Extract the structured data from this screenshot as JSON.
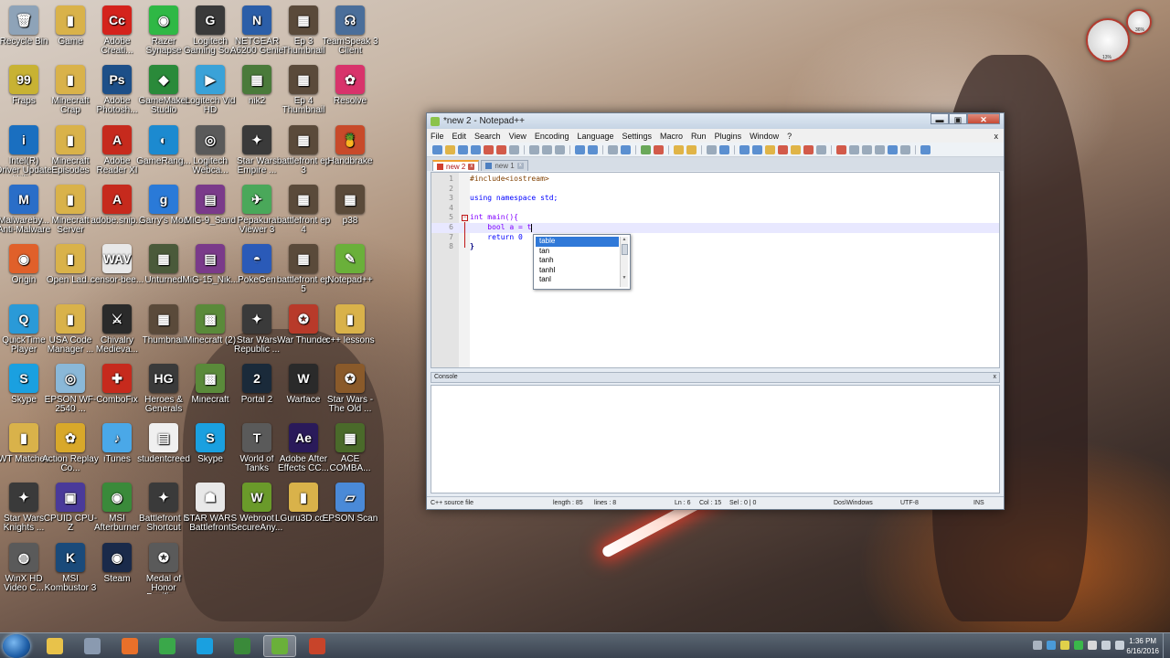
{
  "desktop": {
    "icons": [
      {
        "label": "Recycle Bin",
        "color": "#8ea3b8",
        "glyph": "🗑"
      },
      {
        "label": "Game",
        "color": "#d9b24a",
        "glyph": "▮"
      },
      {
        "label": "Adobe Creati...",
        "color": "#d4231c",
        "glyph": "Cc"
      },
      {
        "label": "Razer Synapse",
        "color": "#2fb845",
        "glyph": "◉"
      },
      {
        "label": "Logitech Gaming So...",
        "color": "#3a3a3a",
        "glyph": "G"
      },
      {
        "label": "NETGEAR A6200 Genie",
        "color": "#2b5ea8",
        "glyph": "N"
      },
      {
        "label": "Ep 3 Thumbnail",
        "color": "#5a4a3a",
        "glyph": "▦"
      },
      {
        "label": "TeamSpeak 3 Client",
        "color": "#4a6e9a",
        "glyph": "☊"
      },
      {
        "label": "Fraps",
        "color": "#c8b233",
        "glyph": "99"
      },
      {
        "label": "Minecraft Crap",
        "color": "#d9b24a",
        "glyph": "▮"
      },
      {
        "label": "Adobe Photosh...",
        "color": "#1d4f88",
        "glyph": "Ps"
      },
      {
        "label": "GameMaker Studio",
        "color": "#2a8a3a",
        "glyph": "◆"
      },
      {
        "label": "Logitech Vid HD",
        "color": "#3aa2d8",
        "glyph": "▶"
      },
      {
        "label": "nik2",
        "color": "#4a7a3a",
        "glyph": "▦"
      },
      {
        "label": "Ep 4 Thumbnail",
        "color": "#5a4a3a",
        "glyph": "▦"
      },
      {
        "label": "Resolve",
        "color": "#d8336b",
        "glyph": "✿"
      },
      {
        "label": "Intel(R) Driver Update Utili...",
        "color": "#1a6fc0",
        "glyph": "i"
      },
      {
        "label": "Minecraft Episodes",
        "color": "#d9b24a",
        "glyph": "▮"
      },
      {
        "label": "Adobe Reader XI",
        "color": "#c62a1d",
        "glyph": "A"
      },
      {
        "label": "GameRang...",
        "color": "#1c8ad0",
        "glyph": "◐"
      },
      {
        "label": "Logitech Webca...",
        "color": "#5a5a5a",
        "glyph": "◎"
      },
      {
        "label": "Star Wars Empire ...",
        "color": "#3a3a3a",
        "glyph": "✦"
      },
      {
        "label": "battlefront ep 3",
        "color": "#5a4a3a",
        "glyph": "▦"
      },
      {
        "label": "Handbrake",
        "color": "#c84a2a",
        "glyph": "🍍"
      },
      {
        "label": "Malwareby... Anti-Malware",
        "color": "#2a6ec8",
        "glyph": "M"
      },
      {
        "label": "Minecraft Server",
        "color": "#d9b24a",
        "glyph": "▮"
      },
      {
        "label": "adobe.snip...",
        "color": "#c62a1d",
        "glyph": "A"
      },
      {
        "label": "Garry's Mod",
        "color": "#2a7ad8",
        "glyph": "g"
      },
      {
        "label": "MiG-9_Sand",
        "color": "#7a3a8a",
        "glyph": "▤"
      },
      {
        "label": "Pepakura Viewer 3",
        "color": "#4aa85a",
        "glyph": "✈"
      },
      {
        "label": "battlefront ep 4",
        "color": "#5a4a3a",
        "glyph": "▦"
      },
      {
        "label": "p38",
        "color": "#5a4a3a",
        "glyph": "▦"
      },
      {
        "label": "Origin",
        "color": "#e0602a",
        "glyph": "◉"
      },
      {
        "label": "Open Lad...",
        "color": "#d9b24a",
        "glyph": "▮"
      },
      {
        "label": "censor-bee...",
        "color": "#e8e8e8",
        "glyph": "WAV"
      },
      {
        "label": "Unturned",
        "color": "#4a5a3a",
        "glyph": "▦"
      },
      {
        "label": "MiG-15_Nik...",
        "color": "#7a3a8a",
        "glyph": "▤"
      },
      {
        "label": "PokeGen",
        "color": "#2a5ab8",
        "glyph": "◓"
      },
      {
        "label": "battlefront ep 5",
        "color": "#5a4a3a",
        "glyph": "▦"
      },
      {
        "label": "Notepad++",
        "color": "#6ab03a",
        "glyph": "✎"
      },
      {
        "label": "QuickTime Player",
        "color": "#2a9ad8",
        "glyph": "Q"
      },
      {
        "label": "USA Code Manager ...",
        "color": "#d9b24a",
        "glyph": "▮"
      },
      {
        "label": "Chivalry Medieva...",
        "color": "#2a2a2a",
        "glyph": "⚔"
      },
      {
        "label": "Thumbnail",
        "color": "#5a4a3a",
        "glyph": "▦"
      },
      {
        "label": "Minecraft (2)",
        "color": "#5a8a3a",
        "glyph": "▩"
      },
      {
        "label": "Star Wars Republic ...",
        "color": "#3a3a3a",
        "glyph": "✦"
      },
      {
        "label": "War Thunder",
        "color": "#b83a2a",
        "glyph": "✪"
      },
      {
        "label": "c++ lessons",
        "color": "#d9b24a",
        "glyph": "▮"
      },
      {
        "label": "Skype",
        "color": "#1aa0e0",
        "glyph": "S"
      },
      {
        "label": "EPSON WF-2540 ...",
        "color": "#8ab8d8",
        "glyph": "◎"
      },
      {
        "label": "ComboFix",
        "color": "#c62a1d",
        "glyph": "✚"
      },
      {
        "label": "Heroes & Generals",
        "color": "#3a3a3a",
        "glyph": "HG"
      },
      {
        "label": "Minecraft",
        "color": "#5a8a3a",
        "glyph": "▩"
      },
      {
        "label": "Portal 2",
        "color": "#1a2a3a",
        "glyph": "2"
      },
      {
        "label": "Warface",
        "color": "#2a2a2a",
        "glyph": "W"
      },
      {
        "label": "Star Wars - The Old ...",
        "color": "#8a5a2a",
        "glyph": "✪"
      },
      {
        "label": "WT Matches",
        "color": "#d9b24a",
        "glyph": "▮"
      },
      {
        "label": "Action Replay Co...",
        "color": "#d8a82a",
        "glyph": "✿"
      },
      {
        "label": "iTunes",
        "color": "#4aa8e8",
        "glyph": "♪"
      },
      {
        "label": "studentcreed",
        "color": "#f0f0f0",
        "glyph": "▤"
      },
      {
        "label": "Skype",
        "color": "#1aa0e0",
        "glyph": "S"
      },
      {
        "label": "World of Tanks",
        "color": "#5a5a5a",
        "glyph": "T"
      },
      {
        "label": "Adobe After Effects CC...",
        "color": "#2a1a5a",
        "glyph": "Ae"
      },
      {
        "label": "ACE COMBA...",
        "color": "#4a6a2a",
        "glyph": "▦"
      },
      {
        "label": "Star Wars Knights ...",
        "color": "#3a3a3a",
        "glyph": "✦"
      },
      {
        "label": "CPUID CPU-Z",
        "color": "#4a3a9a",
        "glyph": "▣"
      },
      {
        "label": "MSI Afterburner",
        "color": "#3a8a3a",
        "glyph": "◉"
      },
      {
        "label": "Battlefront II Shortcut",
        "color": "#3a3a3a",
        "glyph": "✦"
      },
      {
        "label": "STAR WARS Battlefront",
        "color": "#e8e8e8",
        "glyph": "☗"
      },
      {
        "label": "Webroot SecureAny...",
        "color": "#6a9a2a",
        "glyph": "W"
      },
      {
        "label": "LGuru3D.co...",
        "color": "#d9b24a",
        "glyph": "▮"
      },
      {
        "label": "EPSON Scan",
        "color": "#4a8ad8",
        "glyph": "▱"
      },
      {
        "label": "WinX HD Video C...",
        "color": "#5a5a5a",
        "glyph": "◍"
      },
      {
        "label": "MSI Kombustor 3",
        "color": "#1a4a7a",
        "glyph": "K"
      },
      {
        "label": "Steam",
        "color": "#1a2a4a",
        "glyph": "◉"
      },
      {
        "label": "Medal of Honor Pacific...",
        "color": "#5a5a5a",
        "glyph": "✪"
      }
    ]
  },
  "gadget": {
    "cpu_pct": "13%",
    "ram_pct": "36%"
  },
  "notepad": {
    "title": "*new 2 - Notepad++",
    "buttons": {
      "minimize": "▬",
      "maximize": "▣",
      "close": "✕"
    },
    "menu": [
      "File",
      "Edit",
      "Search",
      "View",
      "Encoding",
      "Language",
      "Settings",
      "Macro",
      "Run",
      "Plugins",
      "Window",
      "?"
    ],
    "menu_close": "x",
    "tabs": [
      {
        "label": "new 2",
        "active": true
      },
      {
        "label": "new 1",
        "active": false
      }
    ],
    "lines": [
      {
        "num": "1",
        "code": "#include<iostream>"
      },
      {
        "num": "2",
        "code": ""
      },
      {
        "num": "3",
        "code": "using namespace std;"
      },
      {
        "num": "4",
        "code": ""
      },
      {
        "num": "5",
        "code": "int main(){"
      },
      {
        "num": "6",
        "code": "    bool a = t"
      },
      {
        "num": "7",
        "code": "    return 0"
      },
      {
        "num": "8",
        "code": "}"
      }
    ],
    "autocomplete": [
      "table",
      "tan",
      "tanh",
      "tanhl",
      "tanl"
    ],
    "console_label": "Console",
    "console_close": "x",
    "status": {
      "type": "C++ source file",
      "length": "length : 85",
      "lines": "lines : 8",
      "ln": "Ln : 6",
      "col": "Col : 15",
      "sel": "Sel : 0 | 0",
      "eol": "Dos\\Windows",
      "encoding": "UTF-8",
      "mode": "INS"
    }
  },
  "taskbar": {
    "apps": [
      {
        "name": "explorer",
        "color": "#e8c24a"
      },
      {
        "name": "tools",
        "color": "#8a9ab0"
      },
      {
        "name": "firefox",
        "color": "#e8702a"
      },
      {
        "name": "chrome",
        "color": "#3aa84a"
      },
      {
        "name": "skype",
        "color": "#1aa0e0"
      },
      {
        "name": "xbox",
        "color": "#3a8a3a"
      },
      {
        "name": "notepadpp",
        "color": "#6ab03a"
      },
      {
        "name": "powerpoint",
        "color": "#c8442a"
      }
    ],
    "time": "1:36 PM",
    "date": "6/16/2016"
  }
}
